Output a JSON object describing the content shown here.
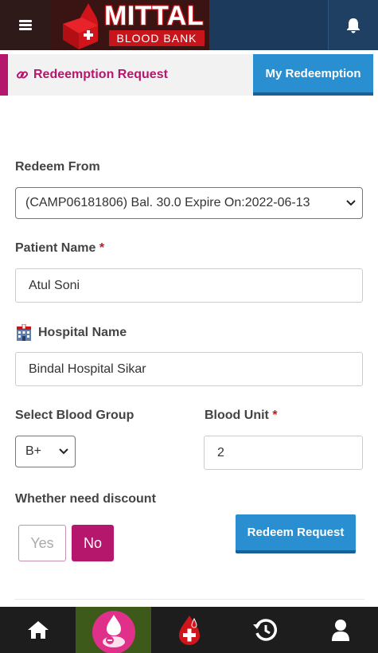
{
  "header": {
    "brand": "MITTAL",
    "brand_sub": "BLOOD BANK",
    "menu_icon": "hamburger-icon",
    "bell_icon": "bell-icon"
  },
  "tabs": {
    "active_label": "Redeemption Request",
    "other_label": "My Redeemption"
  },
  "form": {
    "redeem_from_label": "Redeem From",
    "redeem_from_value": "(CAMP06181806) Bal. 30.0 Expire On:2022-06-13",
    "patient_name_label": "Patient Name",
    "patient_name_value": "Atul Soni",
    "hospital_name_label": "Hospital Name",
    "hospital_name_value": "Bindal Hospital Sikar",
    "blood_group_label": "Select Blood Group",
    "blood_group_value": "B+",
    "blood_unit_label": "Blood Unit",
    "blood_unit_value": "2",
    "required_mark": "*",
    "discount_label": "Whether need discount",
    "yes_label": "Yes",
    "no_label": "No",
    "submit_label": "Redeem Request"
  },
  "bottom_nav": {
    "items": [
      "home-icon",
      "donor-icon",
      "blood-drop-icon",
      "history-icon",
      "profile-icon"
    ]
  },
  "colors": {
    "primary": "#b5176d",
    "accent_blue": "#2a8fd0",
    "header_blue": "#1c3a5c",
    "brand_red": "#c8151b"
  }
}
